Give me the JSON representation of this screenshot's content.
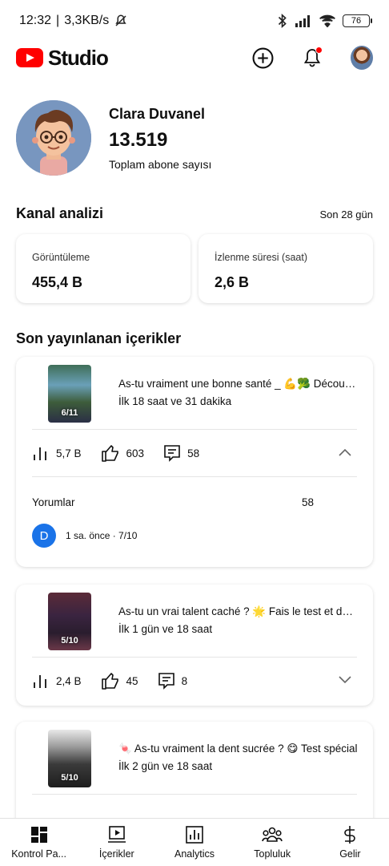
{
  "status_bar": {
    "time": "12:32",
    "speed": "3,3KB/s",
    "battery": "76"
  },
  "header": {
    "logo_text": "Studio"
  },
  "profile": {
    "name": "Clara Duvanel",
    "subscribers": "13.519",
    "subscribers_label": "Toplam abone sayısı"
  },
  "analytics": {
    "title": "Kanal analizi",
    "period": "Son 28 gün",
    "cards": [
      {
        "label": "Görüntüleme",
        "value": "455,4 B"
      },
      {
        "label": "İzlenme süresi (saat)",
        "value": "2,6 B"
      }
    ]
  },
  "recent": {
    "title": "Son yayınlanan içerikler",
    "videos": [
      {
        "title": "As-tu vraiment une bonne santé _ 💪🥦 Découvre-le maintenant",
        "subtitle": "İlk 18 saat ve 31 dakika",
        "thumb_label": "6/11",
        "views": "5,7 B",
        "likes": "603",
        "comments": "58",
        "expanded": true
      },
      {
        "title": "As-tu un vrai talent caché ? 🌟 Fais le test et découvre-le",
        "subtitle": "İlk 1 gün ve 18 saat",
        "thumb_label": "5/10",
        "views": "2,4 B",
        "likes": "45",
        "comments": "8",
        "expanded": false
      },
      {
        "title": "🍬 As-tu vraiment la dent sucrée ? 😋 Test spécial",
        "subtitle": "İlk 2 gün ve 18 saat",
        "thumb_label": "5/10",
        "views": "",
        "likes": "",
        "comments": "",
        "expanded": false
      }
    ],
    "comments_panel": {
      "label": "Yorumlar",
      "count": "58",
      "latest_initial": "D",
      "latest_meta": "1 sa. önce · 7/10"
    }
  },
  "bottom_nav": [
    {
      "label": "Kontrol Pa...",
      "icon": "dashboard-icon"
    },
    {
      "label": "İçerikler",
      "icon": "content-icon"
    },
    {
      "label": "Analytics",
      "icon": "analytics-icon"
    },
    {
      "label": "Topluluk",
      "icon": "community-icon"
    },
    {
      "label": "Gelir",
      "icon": "earn-icon"
    }
  ],
  "colors": {
    "brand_red": "#ff0000",
    "comment_avatar": "#1a73e8"
  }
}
